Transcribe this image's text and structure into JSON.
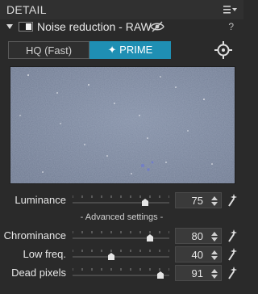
{
  "panel": {
    "title": "DETAIL"
  },
  "module": {
    "title": "Noise reduction - RAW",
    "help": "?"
  },
  "modes": {
    "hq_label": "HQ (Fast)",
    "prime_label": "✦ PRIME",
    "active": "PRIME"
  },
  "controls": {
    "luminance": {
      "label": "Luminance",
      "value": "75"
    },
    "advanced_label": "- Advanced settings -",
    "chrominance": {
      "label": "Chrominance",
      "value": "80"
    },
    "low_freq": {
      "label": "Low freq.",
      "value": "40"
    },
    "dead_pixels": {
      "label": "Dead pixels",
      "value": "91"
    }
  },
  "colors": {
    "accent": "#1f8fb3",
    "panel_bg": "#2a2a2a",
    "preview_bg": "#7e8aa0"
  }
}
